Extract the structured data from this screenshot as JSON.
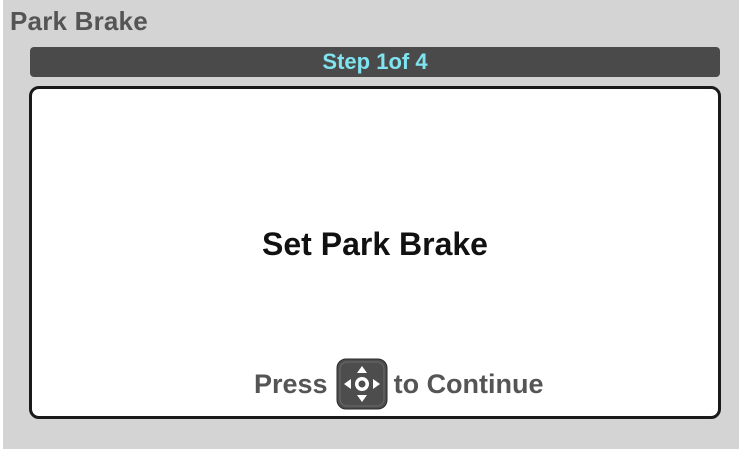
{
  "header": {
    "title": "Park Brake"
  },
  "step": {
    "label": "Step 1of 4"
  },
  "panel": {
    "message": "Set Park Brake",
    "prompt_before": "Press",
    "prompt_after": "to Continue",
    "pad_icon": "directional-pad-icon"
  },
  "colors": {
    "screen_bg": "#d4d4d4",
    "step_bar_bg": "#4a4a4a",
    "step_text": "#7fe3f0",
    "title_text": "#555555",
    "message_text": "#111111"
  }
}
